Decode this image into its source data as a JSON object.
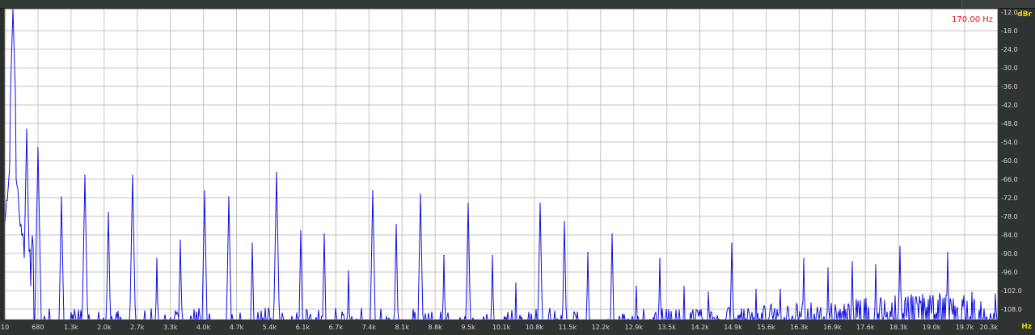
{
  "chart_data": {
    "type": "line",
    "title": "",
    "x_unit": "Hz",
    "y_unit": "dBr",
    "cursor_readout": "170.00 Hz",
    "grid": true,
    "colors": {
      "trace": "#1010e0",
      "grid": "#c4c4c4",
      "axis_text": "#d8d8d8",
      "unit_text": "#f2d200",
      "readout": "#e8141a"
    },
    "x_tick_labels": [
      "10",
      "680",
      "1.3k",
      "2.0k",
      "2.7k",
      "3.3k",
      "4.0k",
      "4.7k",
      "5.4k",
      "6.1k",
      "6.7k",
      "7.4k",
      "8.1k",
      "8.8k",
      "9.5k",
      "10.1k",
      "10.8k",
      "11.5k",
      "12.2k",
      "12.9k",
      "13.5k",
      "14.2k",
      "14.9k",
      "15.6k",
      "16.3k",
      "16.9k",
      "17.6k",
      "18.3k",
      "19.0k",
      "19.7k",
      "20.3k"
    ],
    "xlim": [
      10,
      20300
    ],
    "y_tick_labels": [
      "-12.0",
      "-18.0",
      "-24.0",
      "-30.0",
      "-36.0",
      "-42.0",
      "-48.0",
      "-54.0",
      "-60.0",
      "-66.0",
      "-72.0",
      "-78.0",
      "-84.0",
      "-90.0",
      "-96.0",
      "-102.0",
      "-108.0"
    ],
    "ylim": [
      -113,
      -12
    ],
    "floor_db": -113,
    "peaks": {
      "x": [
        170,
        460,
        680,
        1170,
        1640,
        2130,
        2620,
        3110,
        3600,
        4090,
        4580,
        5070,
        5560,
        6050,
        6540,
        7030,
        7520,
        8010,
        8500,
        8990,
        9480,
        9970,
        10460,
        10950,
        11440,
        11930,
        12420,
        12910,
        13400,
        13890,
        14380,
        14870,
        15360,
        15850,
        16340,
        16830,
        17320,
        17810,
        18300,
        18790,
        19280,
        19770
      ],
      "y": [
        -12,
        -51,
        -57,
        -73,
        -66,
        -78,
        -66,
        -93,
        -87,
        -71,
        -73,
        -88,
        -65,
        -84,
        -85,
        -97,
        -71,
        -82,
        -72,
        -92,
        -75,
        -92,
        -101,
        -75,
        -81,
        -91,
        -85,
        -102,
        -93,
        -102,
        -104,
        -88,
        -103,
        -103,
        -93,
        -96,
        -94,
        -95,
        -89,
        -106,
        -91,
        -104
      ]
    },
    "noise_seed": 7
  }
}
